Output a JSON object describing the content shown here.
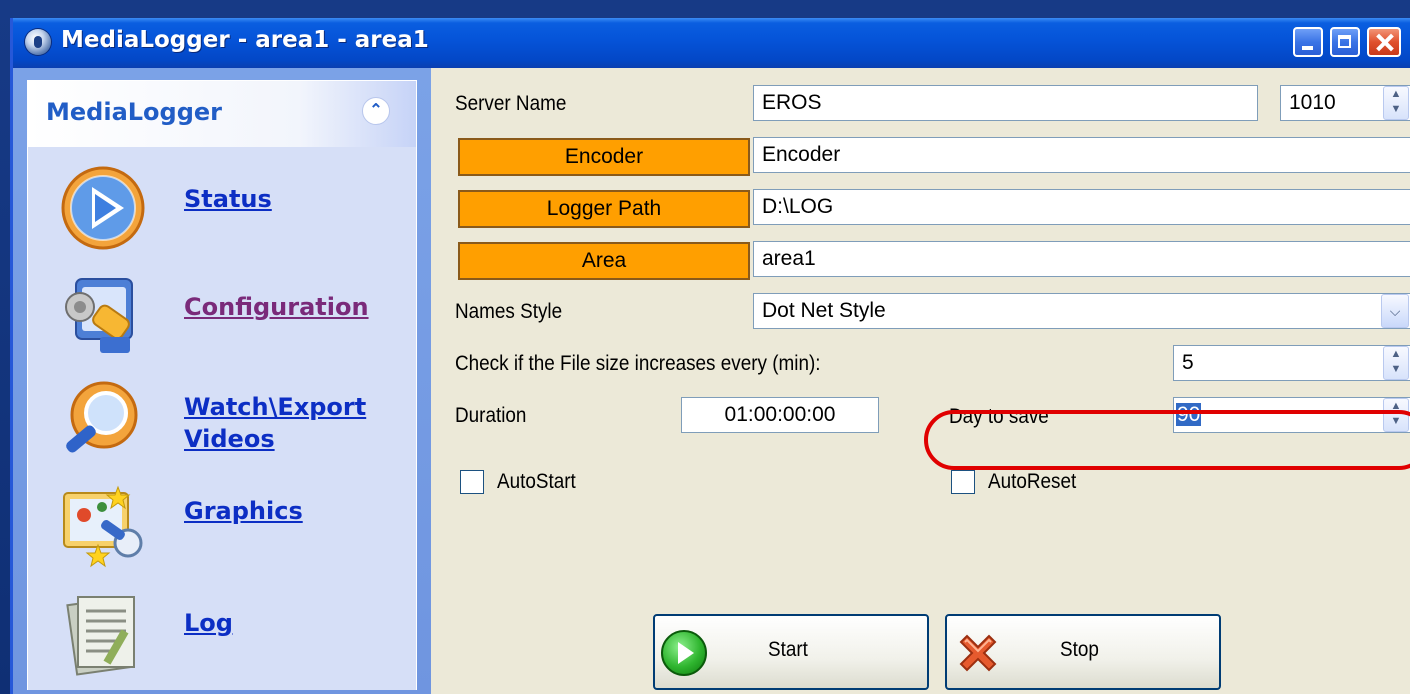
{
  "window": {
    "title": "MediaLogger - area1 - area1"
  },
  "sidebar": {
    "header": "MediaLogger",
    "items": [
      {
        "label": "Status",
        "icon": "play-icon"
      },
      {
        "label": "Configuration",
        "icon": "configuration-tools-icon"
      },
      {
        "label": "Watch\\Export Videos",
        "icon": "magnifier-icon"
      },
      {
        "label": "Graphics",
        "icon": "graphics-icon"
      },
      {
        "label": "Log",
        "icon": "log-document-icon"
      }
    ]
  },
  "config": {
    "server_name_label": "Server Name",
    "server_name_value": "EROS",
    "port_value": "1010",
    "encoder_button": "Encoder",
    "encoder_value": "Encoder",
    "logger_path_button": "Logger Path",
    "logger_path_value": "D:\\LOG",
    "area_button": "Area",
    "area_value": "area1",
    "names_style_label": "Names Style",
    "names_style_value": "Dot Net Style",
    "check_label": "Check if the File size increases every (min):",
    "check_value": "5",
    "duration_label": "Duration",
    "duration_value": "01:00:00:00",
    "day_to_save_label": "Day to save",
    "day_to_save_value": "90",
    "autostart_label": "AutoStart",
    "autoreset_label": "AutoReset",
    "autostart_checked": false,
    "autoreset_checked": false
  },
  "actions": {
    "start_label": "Start",
    "stop_label": "Stop"
  },
  "colors": {
    "accent_orange": "#ff9f00",
    "highlight_red": "#e00000",
    "titlebar_blue": "#0553d8"
  }
}
